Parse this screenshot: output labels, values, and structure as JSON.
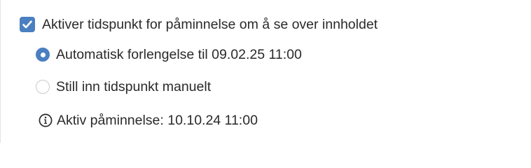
{
  "reminder_settings": {
    "enable_checkbox": {
      "label": "Aktiver tidspunkt for påminnelse om å se over innholdet",
      "checked": true
    },
    "options": [
      {
        "label": "Automatisk forlengelse til 09.02.25 11:00",
        "selected": true
      },
      {
        "label": "Still inn tidspunkt manuelt",
        "selected": false
      }
    ],
    "active_reminder": {
      "text": "Aktiv påminnelse: 10.10.24 11:00",
      "icon": "info-icon"
    }
  },
  "colors": {
    "accent": "#4a7fc1",
    "text": "#2a2a2a",
    "radio_border": "#c9c9c9",
    "divider": "#e3e3e3"
  }
}
